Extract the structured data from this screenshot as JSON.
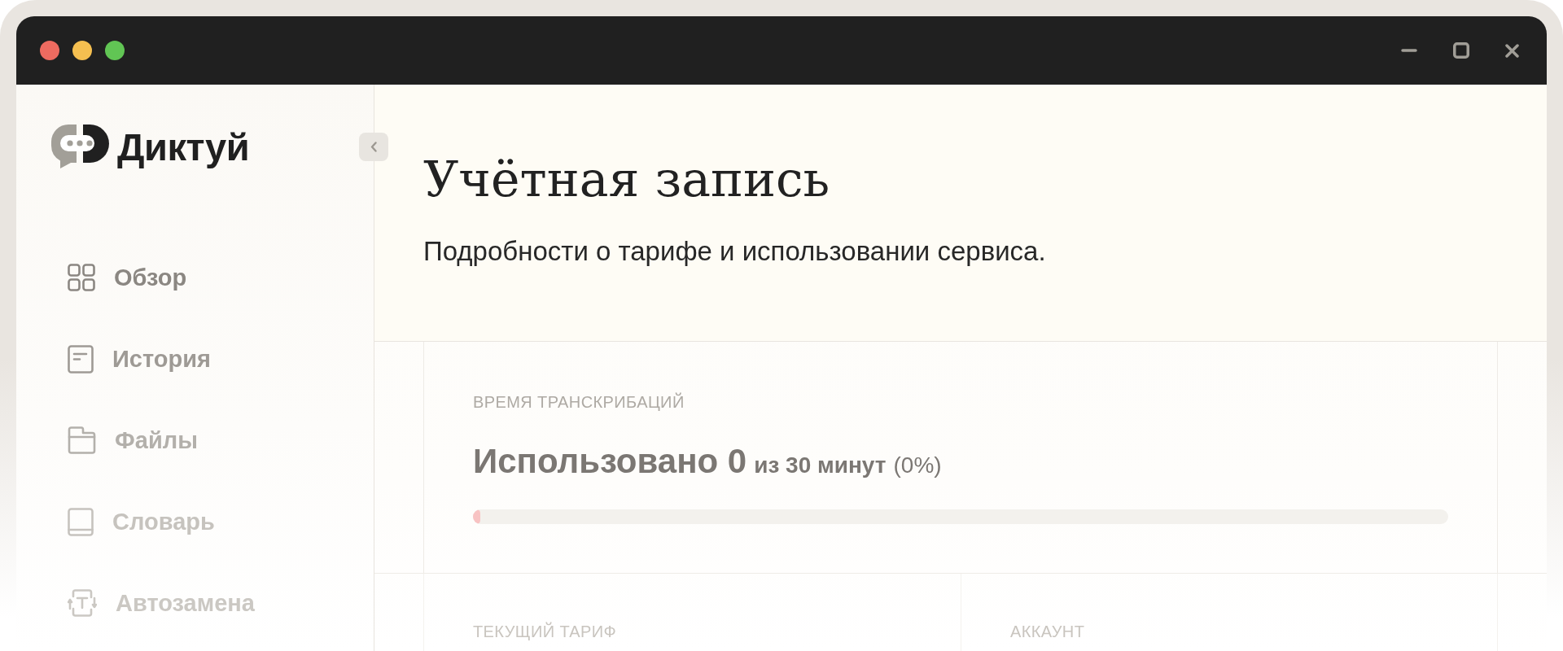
{
  "sidebar": {
    "app_name": "Диктуй",
    "items": [
      {
        "label": "Обзор",
        "kind": "grid",
        "selected": false
      },
      {
        "label": "История",
        "kind": "document",
        "selected": false
      },
      {
        "label": "Файлы",
        "kind": "folder",
        "selected": false
      },
      {
        "label": "Словарь",
        "kind": "book",
        "selected": false
      },
      {
        "label": "Автозамена",
        "kind": "replace",
        "selected": false
      }
    ]
  },
  "header": {
    "title": "Учётная запись",
    "subtitle": "Подробности о тарифе и использовании сервиса."
  },
  "usage_card": {
    "label": "ВРЕМЯ ТРАНСКРИБАЦИЙ",
    "used": "Использовано 0",
    "total": "из 30 минут",
    "percent": "(0%)",
    "level": 0
  },
  "cards": [
    {
      "label": "ТЕКУЩИЙ ТАРИФ"
    },
    {
      "label": "АККАУНТ"
    }
  ]
}
